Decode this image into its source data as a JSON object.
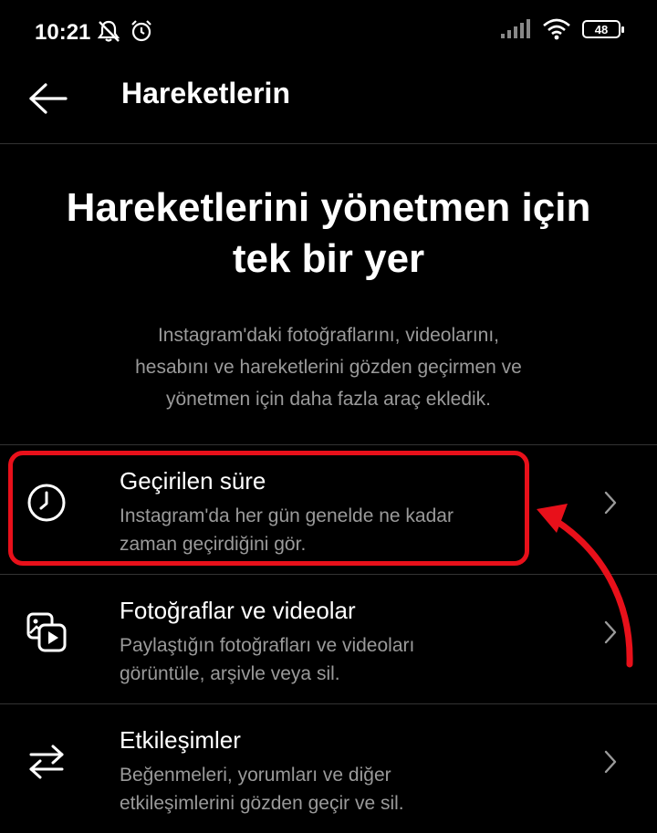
{
  "status_bar": {
    "time": "10:21",
    "battery": "48",
    "icons": [
      "mute-icon",
      "alarm-icon",
      "signal-icon",
      "wifi-icon",
      "battery-icon"
    ]
  },
  "header": {
    "title": "Hareketlerin"
  },
  "hero": {
    "title_line1": "Hareketlerini yönetmen için",
    "title_line2": "tek bir yer",
    "description_line1": "Instagram'daki fotoğraflarını, videolarını,",
    "description_line2": "hesabını ve hareketlerini gözden geçirmen ve",
    "description_line3": "yönetmen için daha fazla araç ekledik."
  },
  "menu": {
    "items": [
      {
        "icon": "clock-icon",
        "title": "Geçirilen süre",
        "desc_line1": "Instagram'da her gün genelde ne kadar",
        "desc_line2": "zaman geçirdiğini gör."
      },
      {
        "icon": "photos-videos-icon",
        "title": "Fotoğraflar ve videolar",
        "desc_line1": "Paylaştığın fotoğrafları ve videoları",
        "desc_line2": "görüntüle, arşivle veya sil."
      },
      {
        "icon": "arrows-exchange-icon",
        "title": "Etkileşimler",
        "desc_line1": "Beğenmeleri, yorumları ve diğer",
        "desc_line2": "etkileşimlerini gözden geçir ve sil."
      }
    ]
  },
  "colors": {
    "background": "#000000",
    "secondary_text": "#9a9a9a",
    "annotation": "#e8101a"
  }
}
